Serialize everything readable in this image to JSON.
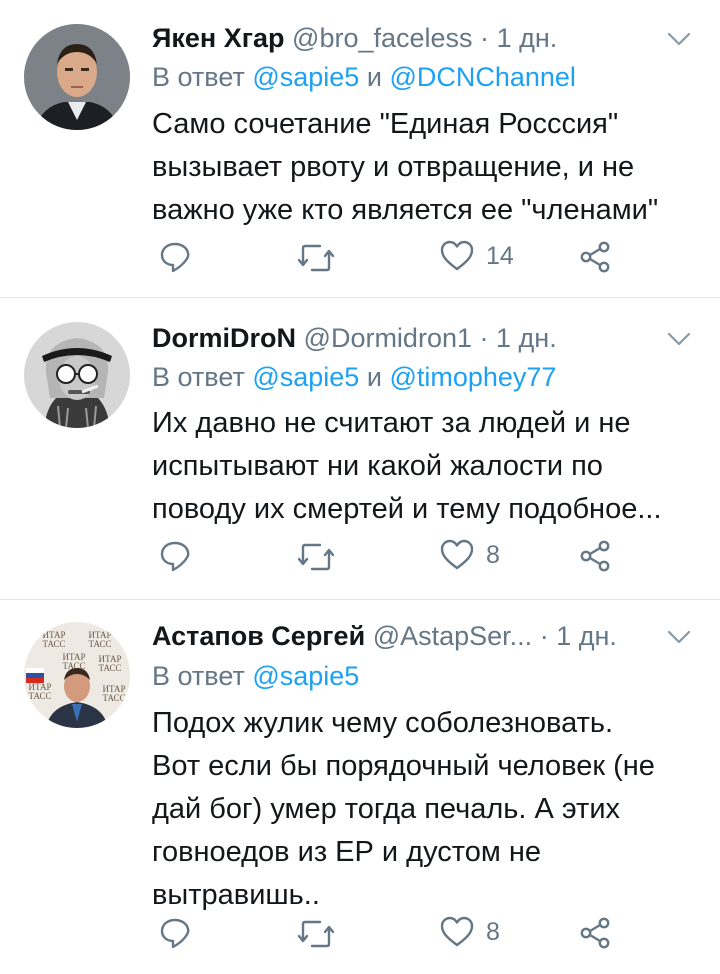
{
  "tweets": [
    {
      "name": "Якен Хгар",
      "handle": "@bro_faceless",
      "dot": "·",
      "time": "1 дн.",
      "reply_prefix": "В ответ",
      "reply_joiner": "и",
      "mention1": "@sapie5",
      "mention2": "@DCNChannel",
      "text_lines": [
        "Само сочетание \"Единая Росссия\"",
        "вызывает рвоту и отвращение, и не",
        "важно уже кто является ее \"членами\""
      ],
      "likes": "14"
    },
    {
      "name": "DormiDroN",
      "handle": "@Dormidron1",
      "dot": "·",
      "time": "1 дн.",
      "reply_prefix": "В ответ",
      "reply_joiner": "и",
      "mention1": "@sapie5",
      "mention2": "@timophey77",
      "text_lines": [
        "Их давно не считают за людей и не",
        "испытывают ни какой жалости по",
        "поводу их смертей и тему подобное..."
      ],
      "likes": "8"
    },
    {
      "name": "Астапов Сергей",
      "handle": "@AstapSer...",
      "dot": "·",
      "time": "1 дн.",
      "reply_prefix": "В ответ",
      "mention1": "@sapie5",
      "text_lines": [
        "Подох жулик чему соболезновать.",
        "Вот если бы порядочный человек (не",
        "дай бог) умер тогда печаль. А этих",
        "говноедов из ЕР и дустом не",
        "вытравишь.."
      ],
      "likes": "8",
      "avatar_text": [
        "ИТАР",
        "ТАСС"
      ]
    }
  ],
  "colors": {
    "text": "#14171a",
    "secondary": "#657786",
    "link": "#1da1f2",
    "divider": "#e1e8ed"
  },
  "icons": [
    "reply-icon",
    "retweet-icon",
    "like-icon",
    "share-icon",
    "chevron-down-icon"
  ]
}
